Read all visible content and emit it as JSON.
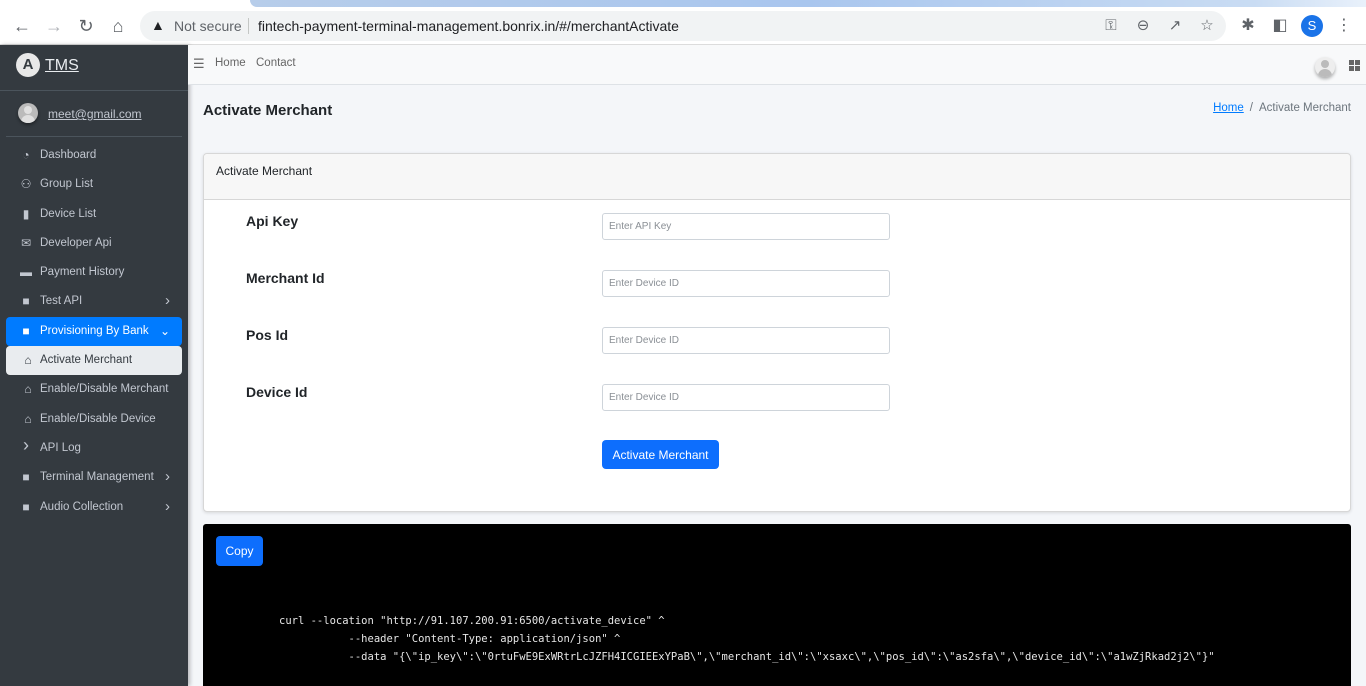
{
  "browser": {
    "security_label": "Not secure",
    "url": "fintech-payment-terminal-management.bonrix.in/#/merchantActivate",
    "profile_initial": "S"
  },
  "sidebar": {
    "brand": "TMS",
    "brand_logo": "A",
    "user_email": "meet@gmail.com",
    "items": [
      {
        "label": "Dashboard",
        "icon": "tachometer-icon"
      },
      {
        "label": "Group List",
        "icon": "users-icon"
      },
      {
        "label": "Device List",
        "icon": "mobile-icon"
      },
      {
        "label": "Developer Api",
        "icon": "envelope-open-icon"
      },
      {
        "label": "Payment History",
        "icon": "credit-card-icon"
      },
      {
        "label": "Test API",
        "icon": "folder-icon",
        "chevron": "right"
      },
      {
        "label": "Provisioning By Bank",
        "icon": "folder-icon",
        "chevron": "down",
        "state": "open"
      },
      {
        "label": "Activate Merchant",
        "icon": "bank-icon",
        "state": "active"
      },
      {
        "label": "Enable/Disable Merchant",
        "icon": "bank-icon"
      },
      {
        "label": "Enable/Disable Device",
        "icon": "bank-icon"
      },
      {
        "label": "API Log",
        "icon": "chevron-right-icon"
      },
      {
        "label": "Terminal Management",
        "icon": "folder-icon",
        "chevron": "right"
      },
      {
        "label": "Audio Collection",
        "icon": "folder-icon",
        "chevron": "right"
      }
    ]
  },
  "header": {
    "links": [
      "Home",
      "Contact"
    ]
  },
  "page": {
    "title": "Activate Merchant",
    "breadcrumb": {
      "home": "Home",
      "current": "Activate Merchant"
    }
  },
  "form": {
    "card_title": "Activate Merchant",
    "fields": [
      {
        "label": "Api Key",
        "placeholder": "Enter API Key",
        "value": ""
      },
      {
        "label": "Merchant Id",
        "placeholder": "Enter Device ID",
        "value": ""
      },
      {
        "label": "Pos Id",
        "placeholder": "Enter Device ID",
        "value": ""
      },
      {
        "label": "Device Id",
        "placeholder": "Enter Device ID",
        "value": ""
      }
    ],
    "submit_label": "Activate Merchant"
  },
  "code_panel": {
    "copy_label": "Copy",
    "lines": [
      "curl --location \"http://91.107.200.91:6500/activate_device\" ^",
      "           --header \"Content-Type: application/json\" ^",
      "           --data \"{\\\"ip_key\\\":\\\"0rtuFwE9ExWRtrLcJZFH4ICGIEExYPaB\\\",\\\"merchant_id\\\":\\\"xsaxc\\\",\\\"pos_id\\\":\\\"as2sfa\\\",\\\"device_id\\\":\\\"a1wZjRkad2j2\\\"}\""
    ]
  },
  "colors": {
    "sidebar_bg": "#343a40",
    "accent": "#0d6efd",
    "link": "#007bff",
    "code_bg": "#000000"
  }
}
